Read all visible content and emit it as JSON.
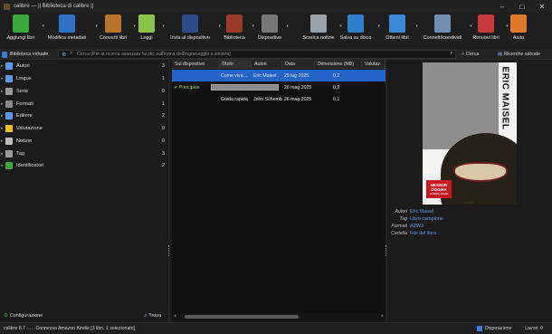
{
  "window": {
    "title": "calibre — || Biblioteca di calibre ||",
    "controls": {
      "minimize": "–",
      "maximize": "□",
      "close": "✕"
    }
  },
  "toolbar": {
    "buttons": [
      {
        "label": "Aggiungi libri",
        "icon": "add-books-icon",
        "color": "#3aa83a"
      },
      {
        "label": "Modifica metadati",
        "icon": "edit-metadata-icon",
        "color": "#2d73c8"
      },
      {
        "label": "Converti libri",
        "icon": "convert-books-icon",
        "color": "#b8742a"
      },
      {
        "label": "Leggi",
        "icon": "read-icon",
        "color": "#8bc34a"
      },
      {
        "label": "Invia al dispositivo",
        "icon": "send-to-device-icon",
        "color": "#2a4d8a"
      },
      {
        "label": "Biblioteca",
        "icon": "library-icon",
        "color": "#9a3b2a"
      },
      {
        "label": "Dispositivo",
        "icon": "device-icon",
        "color": "#777777"
      },
      {
        "label": "Scarica notizie",
        "icon": "fetch-news-icon",
        "color": "#9aa0a8"
      },
      {
        "label": "Salva su disco",
        "icon": "save-to-disk-icon",
        "color": "#2f7fd1"
      },
      {
        "label": "Ottieni libri",
        "icon": "get-books-icon",
        "color": "#3a8ad8"
      },
      {
        "label": "Connetti/condividi",
        "icon": "connect-share-icon",
        "color": "#6f8fb0"
      },
      {
        "label": "Rimuovi libri",
        "icon": "remove-books-icon",
        "color": "#c83a3a"
      },
      {
        "label": "Aiuto",
        "icon": "help-icon",
        "color": "#e07a2a"
      }
    ]
  },
  "search": {
    "virtual_library": "Biblioteca virtuale",
    "placeholder": "Cerca (Per la ricerca avanzata fai clic sull'icona dell'ingranaggio a sinistra)",
    "search_button": "Cerca",
    "saved_searches": "Ricerche salvate"
  },
  "tag_browser": {
    "items": [
      {
        "label": "Autori",
        "count": "3",
        "icon": "authors-icon",
        "color": "#5a9bf0"
      },
      {
        "label": "Lingue",
        "count": "1",
        "icon": "languages-icon",
        "color": "#5a9bf0"
      },
      {
        "label": "Serie",
        "count": "0",
        "icon": "series-icon",
        "color": "#9a9a9a"
      },
      {
        "label": "Formati",
        "count": "1",
        "icon": "formats-icon",
        "color": "#8a8a8a"
      },
      {
        "label": "Editore",
        "count": "2",
        "icon": "publisher-icon",
        "color": "#5a9bf0"
      },
      {
        "label": "Valutazione",
        "count": "0",
        "icon": "rating-star-icon",
        "color": "#f0c020"
      },
      {
        "label": "Notizie",
        "count": "0",
        "icon": "news-icon",
        "color": "#bcbcbc"
      },
      {
        "label": "Tag",
        "count": "3",
        "icon": "tags-icon",
        "color": "#9a9a9a"
      },
      {
        "label": "Identificatori",
        "count": "2",
        "icon": "identifiers-icon",
        "color": "#3aa83a"
      }
    ],
    "configure": "Configurazione",
    "find": "Trova"
  },
  "book_table": {
    "columns": [
      "Sul dispositivo",
      "Titolo",
      "Autori",
      "Data",
      "Dimensione (MB)",
      "Valutaz"
    ],
    "sorted_column": "Titolo",
    "rows": [
      {
        "on_device": "",
        "title": "Come viva…",
        "authors": "Eric Maisel",
        "date": "29 lug 2025",
        "size": "0,2",
        "selected": true,
        "progress": null
      },
      {
        "on_device": "✔ Principale",
        "title": "",
        "authors": "",
        "date": "26 mag 2025",
        "size": "0,9",
        "selected": false,
        "progress": 1.0
      },
      {
        "on_device": "",
        "title": "Guida rapida",
        "authors": "John Schember",
        "date": "26 mag 2025",
        "size": "0,1",
        "selected": false,
        "progress": null
      }
    ]
  },
  "details": {
    "cover": {
      "author_text": "ERIC MAISEL",
      "publisher_logo": [
        "NESSUN",
        "DOGMA"
      ],
      "publisher_sub": "SCIENZE UMANE",
      "page_dots": "• • • •"
    },
    "fields": [
      {
        "key": "Autori",
        "value": "Eric Maisel"
      },
      {
        "key": "Tag",
        "value": "Libro campione"
      },
      {
        "key": "Formati",
        "value": "AZW3"
      },
      {
        "key": "Cartella",
        "value": "File del libro"
      }
    ]
  },
  "status": {
    "text": "calibre 8.7 ·…· Connesso Amazon Kindle   [3 libri, 1 selezionato]",
    "layout": "Disposizione",
    "jobs": "Lavori: 0"
  }
}
